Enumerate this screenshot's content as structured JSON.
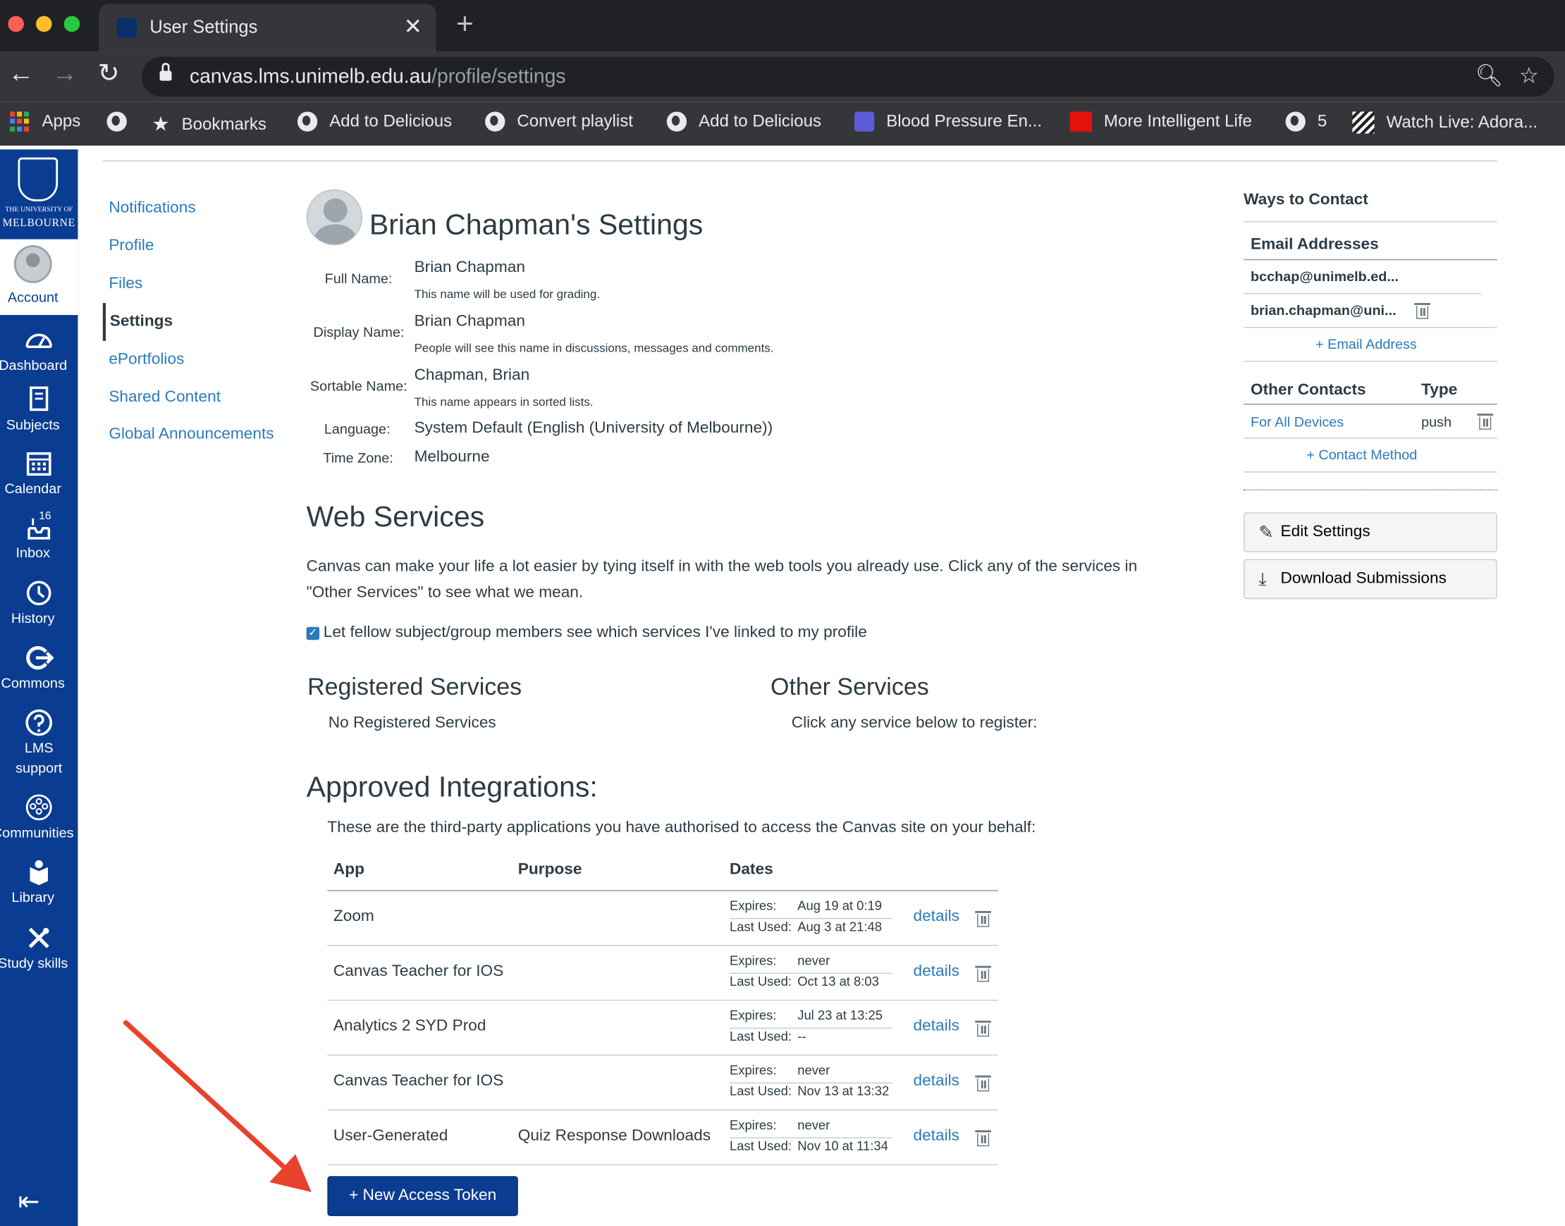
{
  "browser": {
    "tab_title": "User Settings",
    "url_host": "canvas.lms.unimelb.edu.au",
    "url_path": "/profile/settings",
    "bookmarks": [
      {
        "label": "Apps",
        "icon": "apps-grid-icon"
      },
      {
        "label": "",
        "icon": "globe-icon"
      },
      {
        "label": "Bookmarks",
        "icon": "star-icon"
      },
      {
        "label": "Add to Delicious",
        "icon": "globe-icon"
      },
      {
        "label": "Convert playlist",
        "icon": "globe-icon"
      },
      {
        "label": "Add to Delicious",
        "icon": "globe-icon"
      },
      {
        "label": "Blood Pressure En...",
        "icon": "list-icon"
      },
      {
        "label": "More Intelligent Life",
        "icon": "economist-icon"
      },
      {
        "label": "5",
        "icon": "globe-icon"
      },
      {
        "label": "Watch Live: Adora...",
        "icon": "stripes-icon"
      }
    ]
  },
  "global_nav": {
    "logo_line1": "THE UNIVERSITY OF",
    "logo_line2": "MELBOURNE",
    "account": "Account",
    "items": [
      {
        "label": "Dashboard",
        "icon": "dashboard-icon"
      },
      {
        "label": "Subjects",
        "icon": "book-icon"
      },
      {
        "label": "Calendar",
        "icon": "calendar-icon"
      },
      {
        "label": "Inbox",
        "icon": "inbox-icon",
        "badge": "16"
      },
      {
        "label": "History",
        "icon": "clock-icon"
      },
      {
        "label": "Commons",
        "icon": "commons-icon"
      },
      {
        "label": "LMS support",
        "icon": "help-icon"
      },
      {
        "label": "Communities",
        "icon": "communities-icon"
      },
      {
        "label": "Library",
        "icon": "library-icon"
      },
      {
        "label": "Study skills",
        "icon": "tools-icon"
      }
    ]
  },
  "settings_nav": [
    "Notifications",
    "Profile",
    "Files",
    "Settings",
    "ePortfolios",
    "Shared Content",
    "Global Announcements"
  ],
  "profile": {
    "title": "Brian Chapman's Settings",
    "full_name_label": "Full Name:",
    "full_name": "Brian Chapman",
    "full_name_hint": "This name will be used for grading.",
    "display_name_label": "Display Name:",
    "display_name": "Brian Chapman",
    "display_name_hint": "People will see this name in discussions, messages and comments.",
    "sortable_name_label": "Sortable Name:",
    "sortable_name": "Chapman, Brian",
    "sortable_name_hint": "This name appears in sorted lists.",
    "language_label": "Language:",
    "language": "System Default (English (University of Melbourne))",
    "timezone_label": "Time Zone:",
    "timezone": "Melbourne"
  },
  "web_services": {
    "heading": "Web Services",
    "description": "Canvas can make your life a lot easier by tying itself in with the web tools you already use. Click any of the services in \"Other Services\" to see what we mean.",
    "checkbox_label": "Let fellow subject/group members see which services I've linked to my profile",
    "checkbox_checked": true,
    "registered_heading": "Registered Services",
    "registered_empty": "No Registered Services",
    "other_heading": "Other Services",
    "other_text": "Click any service below to register:"
  },
  "integrations": {
    "heading": "Approved Integrations:",
    "description": "These are the third-party applications you have authorised to access the Canvas site on your behalf:",
    "columns": [
      "App",
      "Purpose",
      "Dates"
    ],
    "expires_label": "Expires:",
    "last_used_label": "Last Used:",
    "details_label": "details",
    "rows": [
      {
        "app": "Zoom",
        "purpose": "",
        "expires": "Aug 19 at 0:19",
        "last_used": "Aug 3 at 21:48"
      },
      {
        "app": "Canvas Teacher for IOS",
        "purpose": "",
        "expires": "never",
        "last_used": "Oct 13 at 8:03"
      },
      {
        "app": "Analytics 2 SYD Prod",
        "purpose": "",
        "expires": "Jul 23 at 13:25",
        "last_used": "--"
      },
      {
        "app": "Canvas Teacher for IOS",
        "purpose": "",
        "expires": "never",
        "last_used": "Nov 13 at 13:32"
      },
      {
        "app": "User-Generated",
        "purpose": "Quiz Response Downloads",
        "expires": "never",
        "last_used": "Nov 10 at 11:34"
      }
    ],
    "new_token_label": "+ New Access Token"
  },
  "sidebar": {
    "ways_to_contact": "Ways to Contact",
    "email_heading": "Email Addresses",
    "emails": [
      "bcchap@unimelb.ed...",
      "brian.chapman@uni..."
    ],
    "add_email": "+ Email Address",
    "other_contacts_heading": "Other Contacts",
    "type_heading": "Type",
    "contacts": [
      {
        "name": "For All Devices",
        "type": "push"
      }
    ],
    "add_contact": "+ Contact Method",
    "edit_settings": "Edit Settings",
    "download_submissions": "Download Submissions"
  },
  "colors": {
    "brand": "#0a3d91",
    "link": "#2b7abc",
    "annotation_arrow": "#e8412c"
  }
}
